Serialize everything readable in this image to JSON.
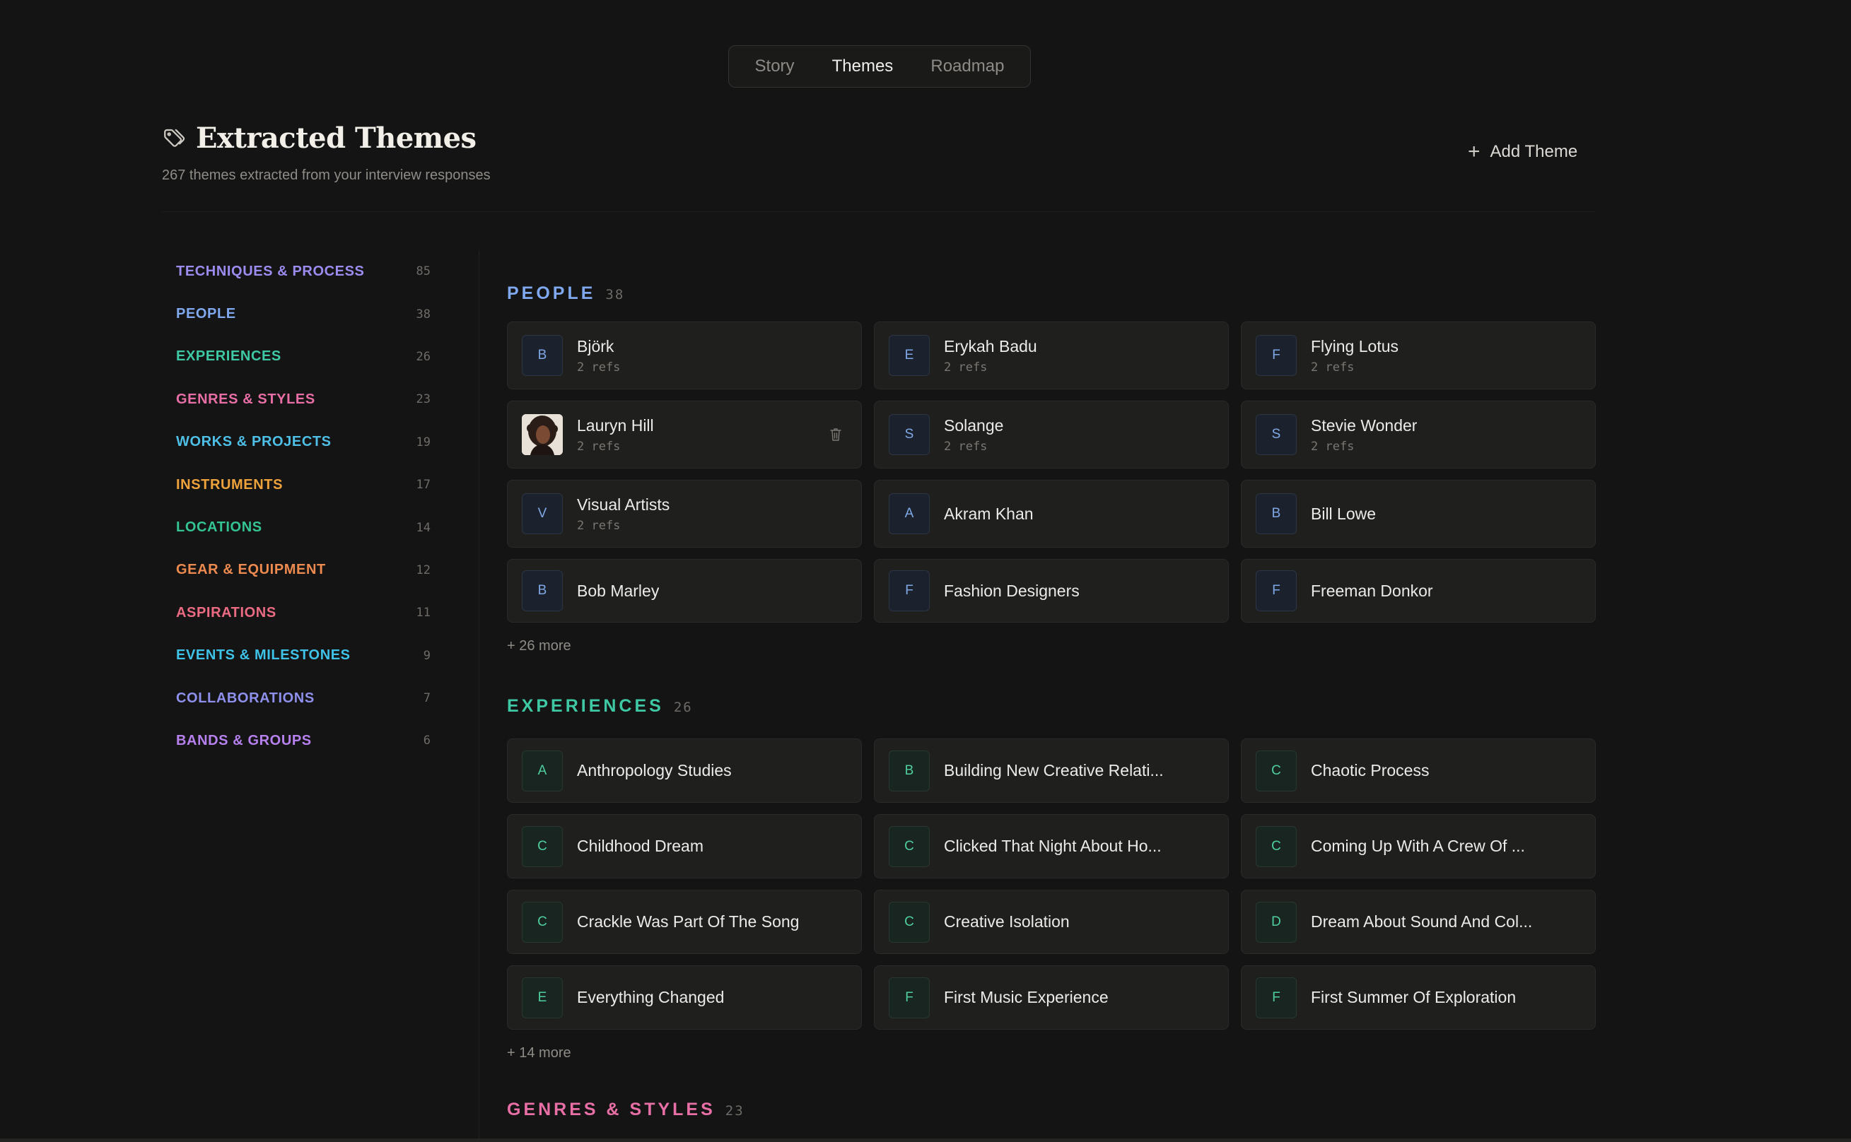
{
  "tabs": [
    {
      "label": "Story",
      "active": false
    },
    {
      "label": "Themes",
      "active": true
    },
    {
      "label": "Roadmap",
      "active": false
    }
  ],
  "header": {
    "title": "Extracted Themes",
    "subtitle": "267 themes extracted from your interview responses",
    "icon": "tag-icon",
    "add_theme_label": "Add Theme"
  },
  "sidebar": {
    "items": [
      {
        "label": "TECHNIQUES & PROCESS",
        "count": "85",
        "color": "#9b8cf0"
      },
      {
        "label": "PEOPLE",
        "count": "38",
        "color": "#7fa8ee"
      },
      {
        "label": "EXPERIENCES",
        "count": "26",
        "color": "#3ec9a4"
      },
      {
        "label": "GENRES & STYLES",
        "count": "23",
        "color": "#e86fa6"
      },
      {
        "label": "WORKS & PROJECTS",
        "count": "19",
        "color": "#4ebfe6"
      },
      {
        "label": "INSTRUMENTS",
        "count": "17",
        "color": "#eda23c"
      },
      {
        "label": "LOCATIONS",
        "count": "14",
        "color": "#34c492"
      },
      {
        "label": "GEAR & EQUIPMENT",
        "count": "12",
        "color": "#ec8a4f"
      },
      {
        "label": "ASPIRATIONS",
        "count": "11",
        "color": "#ea6b82"
      },
      {
        "label": "EVENTS & MILESTONES",
        "count": "9",
        "color": "#3fc2e8"
      },
      {
        "label": "COLLABORATIONS",
        "count": "7",
        "color": "#8f90ec"
      },
      {
        "label": "BANDS & GROUPS",
        "count": "6",
        "color": "#b681ee"
      }
    ]
  },
  "people": {
    "title": "PEOPLE",
    "count": "38",
    "color": "#7fa8ee",
    "cards": [
      {
        "letter": "B",
        "name": "Björk",
        "refs": "2 refs"
      },
      {
        "letter": "E",
        "name": "Erykah Badu",
        "refs": "2 refs"
      },
      {
        "letter": "F",
        "name": "Flying Lotus",
        "refs": "2 refs"
      },
      {
        "letter": "",
        "name": "Lauryn Hill",
        "refs": "2 refs",
        "avatar": true
      },
      {
        "letter": "S",
        "name": "Solange",
        "refs": "2 refs"
      },
      {
        "letter": "S",
        "name": "Stevie Wonder",
        "refs": "2 refs"
      },
      {
        "letter": "V",
        "name": "Visual Artists",
        "refs": "2 refs"
      },
      {
        "letter": "A",
        "name": "Akram Khan",
        "refs": ""
      },
      {
        "letter": "B",
        "name": "Bill Lowe",
        "refs": ""
      },
      {
        "letter": "B",
        "name": "Bob Marley",
        "refs": ""
      },
      {
        "letter": "F",
        "name": "Fashion Designers",
        "refs": ""
      },
      {
        "letter": "F",
        "name": "Freeman Donkor",
        "refs": ""
      }
    ],
    "more": "+ 26 more"
  },
  "experiences": {
    "title": "EXPERIENCES",
    "count": "26",
    "color": "#3ec9a4",
    "cards": [
      {
        "letter": "A",
        "name": "Anthropology Studies"
      },
      {
        "letter": "B",
        "name": "Building New Creative Relati..."
      },
      {
        "letter": "C",
        "name": "Chaotic Process"
      },
      {
        "letter": "C",
        "name": "Childhood Dream"
      },
      {
        "letter": "C",
        "name": "Clicked That Night About Ho..."
      },
      {
        "letter": "C",
        "name": "Coming Up With A Crew Of ..."
      },
      {
        "letter": "C",
        "name": "Crackle Was Part Of The Song"
      },
      {
        "letter": "C",
        "name": "Creative Isolation"
      },
      {
        "letter": "D",
        "name": "Dream About Sound And Col..."
      },
      {
        "letter": "E",
        "name": "Everything Changed"
      },
      {
        "letter": "F",
        "name": "First Music Experience"
      },
      {
        "letter": "F",
        "name": "First Summer Of Exploration"
      }
    ],
    "more": "+ 14 more"
  },
  "genres": {
    "title": "GENRES & STYLES",
    "count": "23",
    "color": "#e86fa6"
  }
}
